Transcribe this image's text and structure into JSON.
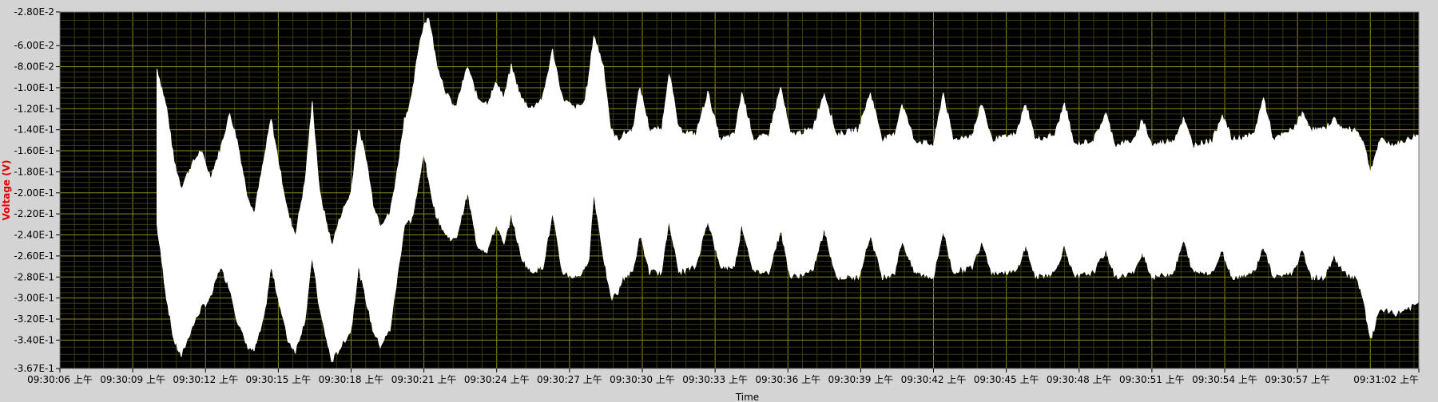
{
  "chart_data": {
    "type": "area",
    "xlabel": "Time",
    "ylabel": "Voltage (V)",
    "x_ticks": [
      "09:30:06 上午",
      "09:30:09 上午",
      "09:30:12 上午",
      "09:30:15 上午",
      "09:30:18 上午",
      "09:30:21 上午",
      "09:30:24 上午",
      "09:30:27 上午",
      "09:30:30 上午",
      "09:30:33 上午",
      "09:30:36 上午",
      "09:30:39 上午",
      "09:30:42 上午",
      "09:30:45 上午",
      "09:30:48 上午",
      "09:30:51 上午",
      "09:30:54 上午",
      "09:30:57 上午",
      "09:31:02 上午"
    ],
    "y_ticks": [
      "-2.80E-2",
      "-6.00E-2",
      "-8.00E-2",
      "-1.00E-1",
      "-1.20E-1",
      "-1.40E-1",
      "-1.60E-1",
      "-1.80E-1",
      "-2.00E-1",
      "-2.20E-1",
      "-2.40E-1",
      "-2.60E-1",
      "-2.80E-1",
      "-3.00E-1",
      "-3.20E-1",
      "-3.40E-1",
      "-3.67E-1"
    ],
    "ylim": [
      -0.367,
      -0.028
    ],
    "xlim_seconds": [
      0,
      56
    ],
    "grid": true,
    "colors": {
      "plot_bg": "#000000",
      "grid": "#8c8c1a",
      "signal": "#ffffff",
      "ylabel": "#e00000"
    },
    "series": [
      {
        "envelope_top": [
          [
            4.0,
            -0.082
          ],
          [
            4.4,
            -0.12
          ],
          [
            4.7,
            -0.17
          ],
          [
            5.0,
            -0.195
          ],
          [
            5.4,
            -0.175
          ],
          [
            5.8,
            -0.16
          ],
          [
            6.2,
            -0.185
          ],
          [
            6.6,
            -0.16
          ],
          [
            7.0,
            -0.125
          ],
          [
            7.3,
            -0.15
          ],
          [
            7.7,
            -0.2
          ],
          [
            8.0,
            -0.22
          ],
          [
            8.4,
            -0.17
          ],
          [
            8.7,
            -0.13
          ],
          [
            9.0,
            -0.17
          ],
          [
            9.4,
            -0.22
          ],
          [
            9.7,
            -0.24
          ],
          [
            10.1,
            -0.19
          ],
          [
            10.4,
            -0.115
          ],
          [
            10.7,
            -0.2
          ],
          [
            11.0,
            -0.23
          ],
          [
            11.2,
            -0.25
          ],
          [
            11.6,
            -0.22
          ],
          [
            12.0,
            -0.2
          ],
          [
            12.3,
            -0.14
          ],
          [
            12.6,
            -0.165
          ],
          [
            12.9,
            -0.21
          ],
          [
            13.2,
            -0.23
          ],
          [
            13.6,
            -0.22
          ],
          [
            13.9,
            -0.18
          ],
          [
            14.2,
            -0.13
          ],
          [
            14.5,
            -0.11
          ],
          [
            14.8,
            -0.06
          ],
          [
            15.0,
            -0.04
          ],
          [
            15.2,
            -0.033
          ],
          [
            15.5,
            -0.075
          ],
          [
            15.9,
            -0.105
          ],
          [
            16.3,
            -0.12
          ],
          [
            16.8,
            -0.08
          ],
          [
            17.2,
            -0.11
          ],
          [
            17.6,
            -0.115
          ],
          [
            18.0,
            -0.095
          ],
          [
            18.3,
            -0.11
          ],
          [
            18.6,
            -0.08
          ],
          [
            19.0,
            -0.11
          ],
          [
            19.4,
            -0.12
          ],
          [
            19.9,
            -0.11
          ],
          [
            20.3,
            -0.065
          ],
          [
            20.7,
            -0.11
          ],
          [
            21.2,
            -0.12
          ],
          [
            21.6,
            -0.115
          ],
          [
            21.8,
            -0.09
          ],
          [
            22.0,
            -0.05
          ],
          [
            22.4,
            -0.08
          ],
          [
            22.7,
            -0.14
          ],
          [
            23.0,
            -0.15
          ],
          [
            23.2,
            -0.145
          ],
          [
            23.6,
            -0.14
          ],
          [
            23.9,
            -0.1
          ],
          [
            24.3,
            -0.14
          ],
          [
            24.8,
            -0.14
          ],
          [
            25.1,
            -0.085
          ],
          [
            25.5,
            -0.14
          ],
          [
            26.2,
            -0.145
          ],
          [
            26.7,
            -0.105
          ],
          [
            27.2,
            -0.15
          ],
          [
            27.8,
            -0.145
          ],
          [
            28.1,
            -0.105
          ],
          [
            28.6,
            -0.15
          ],
          [
            29.2,
            -0.145
          ],
          [
            29.7,
            -0.1
          ],
          [
            30.1,
            -0.145
          ],
          [
            31.0,
            -0.14
          ],
          [
            31.5,
            -0.105
          ],
          [
            32.0,
            -0.145
          ],
          [
            32.9,
            -0.14
          ],
          [
            33.4,
            -0.105
          ],
          [
            33.9,
            -0.15
          ],
          [
            34.4,
            -0.145
          ],
          [
            34.7,
            -0.115
          ],
          [
            35.2,
            -0.15
          ],
          [
            36.0,
            -0.155
          ],
          [
            36.4,
            -0.105
          ],
          [
            36.8,
            -0.15
          ],
          [
            37.6,
            -0.145
          ],
          [
            38.0,
            -0.115
          ],
          [
            38.4,
            -0.15
          ],
          [
            39.4,
            -0.145
          ],
          [
            39.8,
            -0.115
          ],
          [
            40.2,
            -0.15
          ],
          [
            41.0,
            -0.145
          ],
          [
            41.4,
            -0.115
          ],
          [
            41.8,
            -0.155
          ],
          [
            42.6,
            -0.15
          ],
          [
            43.1,
            -0.125
          ],
          [
            43.5,
            -0.155
          ],
          [
            44.3,
            -0.15
          ],
          [
            44.6,
            -0.13
          ],
          [
            45.0,
            -0.155
          ],
          [
            45.9,
            -0.15
          ],
          [
            46.3,
            -0.13
          ],
          [
            46.7,
            -0.155
          ],
          [
            47.5,
            -0.15
          ],
          [
            47.9,
            -0.125
          ],
          [
            48.3,
            -0.15
          ],
          [
            49.2,
            -0.145
          ],
          [
            49.6,
            -0.11
          ],
          [
            50.0,
            -0.15
          ],
          [
            50.8,
            -0.14
          ],
          [
            51.2,
            -0.125
          ],
          [
            51.6,
            -0.14
          ],
          [
            52.1,
            -0.14
          ],
          [
            52.5,
            -0.13
          ],
          [
            52.9,
            -0.14
          ],
          [
            53.4,
            -0.14
          ],
          [
            53.7,
            -0.15
          ],
          [
            54.0,
            -0.18
          ],
          [
            54.4,
            -0.15
          ],
          [
            55.0,
            -0.155
          ],
          [
            55.5,
            -0.15
          ],
          [
            56.0,
            -0.145
          ]
        ],
        "envelope_bottom": [
          [
            4.0,
            -0.23
          ],
          [
            4.4,
            -0.3
          ],
          [
            4.7,
            -0.34
          ],
          [
            5.0,
            -0.355
          ],
          [
            5.4,
            -0.33
          ],
          [
            5.8,
            -0.31
          ],
          [
            6.2,
            -0.3
          ],
          [
            6.6,
            -0.27
          ],
          [
            7.0,
            -0.29
          ],
          [
            7.3,
            -0.32
          ],
          [
            7.7,
            -0.345
          ],
          [
            8.0,
            -0.35
          ],
          [
            8.4,
            -0.32
          ],
          [
            8.7,
            -0.27
          ],
          [
            9.0,
            -0.3
          ],
          [
            9.4,
            -0.34
          ],
          [
            9.7,
            -0.35
          ],
          [
            10.1,
            -0.32
          ],
          [
            10.4,
            -0.26
          ],
          [
            10.7,
            -0.31
          ],
          [
            11.0,
            -0.34
          ],
          [
            11.2,
            -0.36
          ],
          [
            11.6,
            -0.345
          ],
          [
            12.0,
            -0.33
          ],
          [
            12.3,
            -0.27
          ],
          [
            12.6,
            -0.3
          ],
          [
            12.9,
            -0.33
          ],
          [
            13.2,
            -0.345
          ],
          [
            13.6,
            -0.33
          ],
          [
            13.9,
            -0.28
          ],
          [
            14.2,
            -0.23
          ],
          [
            14.5,
            -0.225
          ],
          [
            14.8,
            -0.19
          ],
          [
            15.0,
            -0.16
          ],
          [
            15.2,
            -0.19
          ],
          [
            15.5,
            -0.22
          ],
          [
            15.9,
            -0.24
          ],
          [
            16.3,
            -0.245
          ],
          [
            16.8,
            -0.2
          ],
          [
            17.2,
            -0.25
          ],
          [
            17.6,
            -0.255
          ],
          [
            18.0,
            -0.23
          ],
          [
            18.3,
            -0.25
          ],
          [
            18.6,
            -0.22
          ],
          [
            19.0,
            -0.26
          ],
          [
            19.4,
            -0.275
          ],
          [
            19.9,
            -0.27
          ],
          [
            20.3,
            -0.22
          ],
          [
            20.7,
            -0.275
          ],
          [
            21.2,
            -0.28
          ],
          [
            21.6,
            -0.275
          ],
          [
            21.8,
            -0.26
          ],
          [
            22.0,
            -0.2
          ],
          [
            22.4,
            -0.26
          ],
          [
            22.7,
            -0.3
          ],
          [
            23.0,
            -0.295
          ],
          [
            23.2,
            -0.28
          ],
          [
            23.6,
            -0.275
          ],
          [
            23.9,
            -0.24
          ],
          [
            24.3,
            -0.275
          ],
          [
            24.8,
            -0.275
          ],
          [
            25.1,
            -0.225
          ],
          [
            25.5,
            -0.275
          ],
          [
            26.2,
            -0.27
          ],
          [
            26.7,
            -0.225
          ],
          [
            27.2,
            -0.27
          ],
          [
            27.8,
            -0.27
          ],
          [
            28.1,
            -0.23
          ],
          [
            28.6,
            -0.275
          ],
          [
            29.2,
            -0.275
          ],
          [
            29.7,
            -0.235
          ],
          [
            30.1,
            -0.28
          ],
          [
            31.0,
            -0.275
          ],
          [
            31.5,
            -0.235
          ],
          [
            32.0,
            -0.28
          ],
          [
            32.9,
            -0.28
          ],
          [
            33.4,
            -0.24
          ],
          [
            33.9,
            -0.28
          ],
          [
            34.4,
            -0.275
          ],
          [
            34.7,
            -0.245
          ],
          [
            35.2,
            -0.275
          ],
          [
            36.0,
            -0.28
          ],
          [
            36.4,
            -0.235
          ],
          [
            36.8,
            -0.275
          ],
          [
            37.6,
            -0.27
          ],
          [
            38.0,
            -0.245
          ],
          [
            38.4,
            -0.275
          ],
          [
            39.4,
            -0.275
          ],
          [
            39.8,
            -0.25
          ],
          [
            40.2,
            -0.28
          ],
          [
            41.0,
            -0.275
          ],
          [
            41.4,
            -0.25
          ],
          [
            41.8,
            -0.28
          ],
          [
            42.6,
            -0.275
          ],
          [
            43.1,
            -0.255
          ],
          [
            43.5,
            -0.28
          ],
          [
            44.3,
            -0.275
          ],
          [
            44.6,
            -0.255
          ],
          [
            45.0,
            -0.28
          ],
          [
            45.9,
            -0.275
          ],
          [
            46.3,
            -0.245
          ],
          [
            46.7,
            -0.275
          ],
          [
            47.5,
            -0.275
          ],
          [
            47.9,
            -0.255
          ],
          [
            48.3,
            -0.28
          ],
          [
            49.2,
            -0.275
          ],
          [
            49.6,
            -0.25
          ],
          [
            50.0,
            -0.28
          ],
          [
            50.8,
            -0.275
          ],
          [
            51.2,
            -0.255
          ],
          [
            51.6,
            -0.28
          ],
          [
            52.1,
            -0.28
          ],
          [
            52.5,
            -0.26
          ],
          [
            52.9,
            -0.275
          ],
          [
            53.4,
            -0.28
          ],
          [
            53.7,
            -0.3
          ],
          [
            54.0,
            -0.34
          ],
          [
            54.4,
            -0.31
          ],
          [
            55.0,
            -0.315
          ],
          [
            55.5,
            -0.31
          ],
          [
            56.0,
            -0.305
          ]
        ]
      }
    ]
  }
}
